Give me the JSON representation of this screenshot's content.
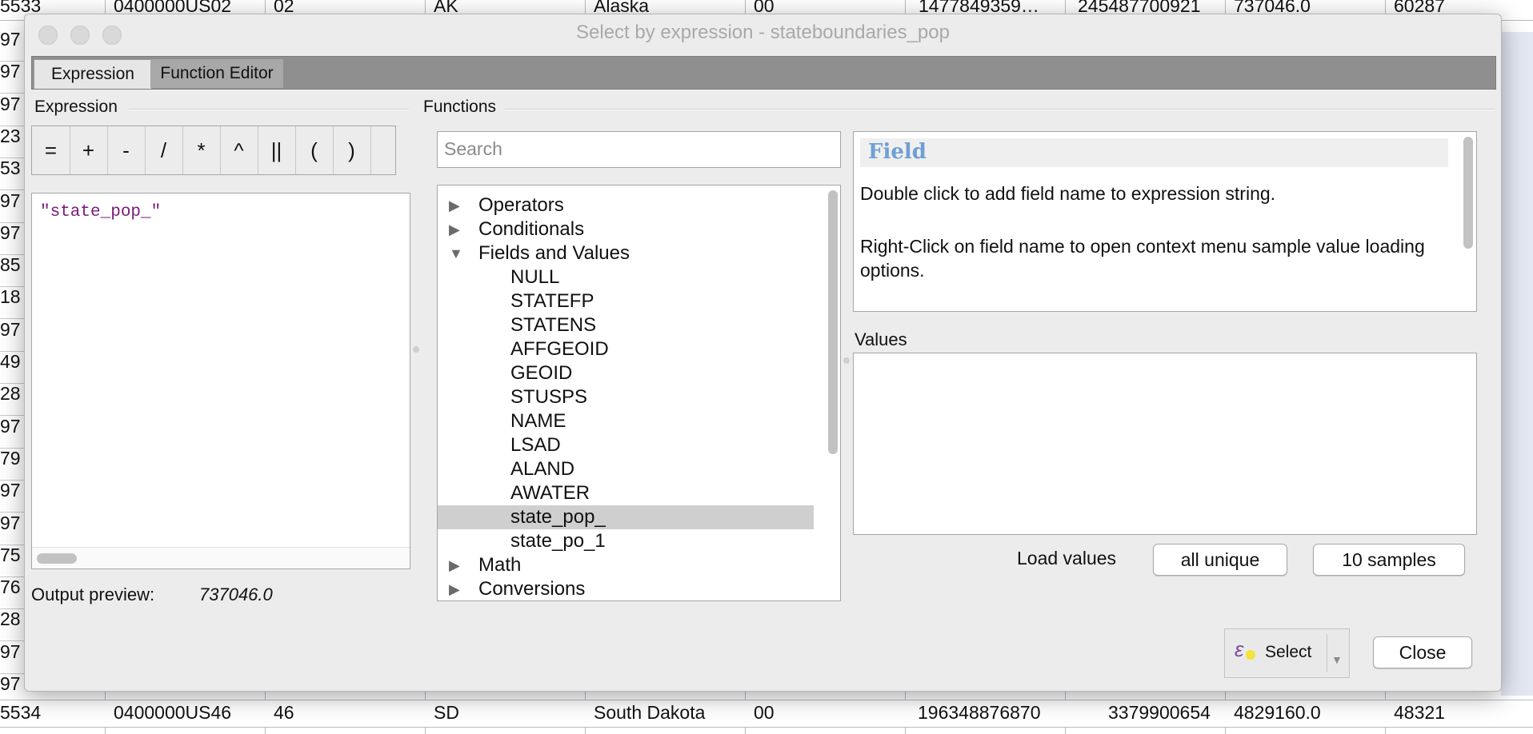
{
  "background_table": {
    "top_row": [
      "5533",
      "0400000US02",
      "02",
      "AK",
      "Alaska",
      "00",
      "1477849359…",
      "245487700921",
      "737046.0",
      "60287"
    ],
    "bottom_row": [
      "5534",
      "0400000US46",
      "46",
      "SD",
      "South Dakota",
      "00",
      "196348876870",
      "3379900654",
      "4829160.0",
      "48321"
    ],
    "left_column": [
      "97",
      "97",
      "97",
      "23",
      "53",
      "97",
      "97",
      "85",
      "18",
      "97",
      "49",
      "28",
      "97",
      "79",
      "97",
      "97",
      "75",
      "76",
      "28",
      "97",
      "97"
    ]
  },
  "dialog": {
    "title": "Select by expression - stateboundaries_pop",
    "tabs": [
      {
        "label": "Expression",
        "active": true
      },
      {
        "label": "Function Editor",
        "active": false
      }
    ],
    "expression_section": "Expression",
    "functions_section": "Functions",
    "operators": [
      "=",
      "+",
      "-",
      "/",
      "*",
      "^",
      "||",
      "(",
      ")"
    ],
    "expression_text": "\"state_pop_\"",
    "output_preview_label": "Output preview:",
    "output_preview_value": "737046.0",
    "search_placeholder": "Search",
    "tree": [
      {
        "label": "Operators",
        "level": 0,
        "expanded": false
      },
      {
        "label": "Conditionals",
        "level": 0,
        "expanded": false
      },
      {
        "label": "Fields and Values",
        "level": 0,
        "expanded": true
      },
      {
        "label": "NULL",
        "level": 1
      },
      {
        "label": "STATEFP",
        "level": 1
      },
      {
        "label": "STATENS",
        "level": 1
      },
      {
        "label": "AFFGEOID",
        "level": 1
      },
      {
        "label": "GEOID",
        "level": 1
      },
      {
        "label": "STUSPS",
        "level": 1
      },
      {
        "label": "NAME",
        "level": 1
      },
      {
        "label": "LSAD",
        "level": 1
      },
      {
        "label": "ALAND",
        "level": 1
      },
      {
        "label": "AWATER",
        "level": 1
      },
      {
        "label": "state_pop_",
        "level": 1,
        "selected": true
      },
      {
        "label": "state_po_1",
        "level": 1
      },
      {
        "label": "Math",
        "level": 0,
        "expanded": false
      },
      {
        "label": "Conversions",
        "level": 0,
        "expanded": false
      }
    ],
    "help": {
      "title": "Field",
      "p1": "Double click to add field name to expression string.",
      "p2": "Right-Click on field name to open context menu sample value loading options."
    },
    "values_label": "Values",
    "load_values_label": "Load values",
    "all_unique_label": "all unique",
    "ten_samples_label": "10 samples",
    "select_label": "Select",
    "close_label": "Close"
  },
  "colors": {
    "help_title": "#6f9fd4",
    "expression_text": "#7a1a7a",
    "selected_row": "#cfcfcf",
    "tab_bar": "#8f8f8f"
  }
}
